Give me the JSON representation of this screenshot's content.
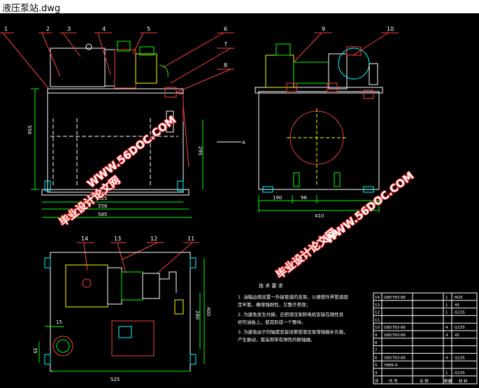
{
  "window": {
    "title": "液压泵站.dwg"
  },
  "drawing": {
    "callouts": [
      "1",
      "2",
      "3",
      "4",
      "5",
      "6",
      "7",
      "8",
      "9",
      "10",
      "11",
      "12",
      "13",
      "14"
    ],
    "view_label": "A",
    "dimensions": {
      "front_height": "556",
      "front_inner": "525",
      "front_mid": "558",
      "front_overall": "585",
      "front_level": "295",
      "side_left": "190",
      "side_right": "96",
      "side_overall": "410",
      "top_small": "15",
      "top_side": "35",
      "top_inner": "280",
      "top_height": "400",
      "top_width": "525"
    },
    "watermark": {
      "url": "WWW.56DOC.COM",
      "text": "毕业设计论文网"
    },
    "notes": {
      "title": "技 术 要 求",
      "items": [
        "1. 油箱边缘设置一外接管道的支架，以便使外界管道固",
        "   定牢靠，确增强刚性，又整齐美观；",
        "2. 为避免发生共振，应把液压泵和电机安装在刚性良",
        "   好的油板上，使其形成一个整体。",
        "3. 为避免由于同轴度安装误差使液压泵增强振补负载，",
        "   产生振动，需采用带有弹性的联轴器。"
      ]
    },
    "bom": {
      "rows": [
        {
          "no": "14",
          "code": "GB5783-86",
          "qty": "1",
          "spec": "M25"
        },
        {
          "no": "13",
          "code": "",
          "qty": "1",
          "spec": "45"
        },
        {
          "no": "12",
          "code": "",
          "qty": "1",
          "spec": "Q235"
        },
        {
          "no": "11",
          "code": "",
          "qty": "",
          "spec": ""
        },
        {
          "no": "10",
          "code": "GB5783-86",
          "qty": "4",
          "spec": "Q235"
        },
        {
          "no": "9",
          "code": "GB5783-86",
          "qty": "4",
          "spec": "45"
        },
        {
          "no": "8",
          "code": "",
          "qty": "",
          "spec": ""
        },
        {
          "no": "7",
          "code": "",
          "qty": "",
          "spec": ""
        },
        {
          "no": "6",
          "code": "GB5783-86",
          "qty": "4",
          "spec": "Q235"
        },
        {
          "no": "5",
          "code": "YB86-6",
          "qty": "",
          "spec": ""
        },
        {
          "no": "4",
          "code": "",
          "qty": "1",
          "spec": "Q235"
        }
      ],
      "header": [
        "序",
        "代 号",
        "名 称",
        "数量",
        "材 料"
      ]
    }
  }
}
